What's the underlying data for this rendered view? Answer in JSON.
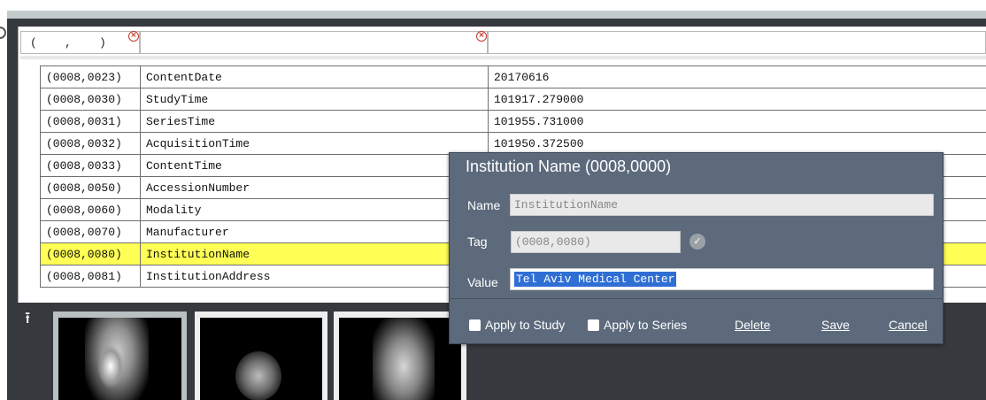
{
  "filters": {
    "tag_value": "(    ,    )",
    "name_value": "",
    "value_value": ""
  },
  "rows": [
    {
      "tag": "(0008,0023)",
      "name": "ContentDate",
      "value": "20170616"
    },
    {
      "tag": "(0008,0030)",
      "name": "StudyTime",
      "value": "101917.279000"
    },
    {
      "tag": "(0008,0031)",
      "name": "SeriesTime",
      "value": "101955.731000"
    },
    {
      "tag": "(0008,0032)",
      "name": "AcquisitionTime",
      "value": "101950.372500"
    },
    {
      "tag": "(0008,0033)",
      "name": "ContentTime",
      "value": ""
    },
    {
      "tag": "(0008,0050)",
      "name": "AccessionNumber",
      "value": ""
    },
    {
      "tag": "(0008,0060)",
      "name": "Modality",
      "value": ""
    },
    {
      "tag": "(0008,0070)",
      "name": "Manufacturer",
      "value": ""
    },
    {
      "tag": "(0008,0080)",
      "name": "InstitutionName",
      "value": "",
      "selected": true
    },
    {
      "tag": "(0008,0081)",
      "name": "InstitutionAddress",
      "value": ""
    }
  ],
  "dialog": {
    "title": "Institution Name (0008,0000)",
    "name_label": "Name",
    "name_value": "InstitutionName",
    "tag_label": "Tag",
    "tag_value": "(0008,0080)",
    "value_label": "Value",
    "value_value": "Tel Aviv Medical Center",
    "apply_study_label": "Apply to Study",
    "apply_series_label": "Apply to Series",
    "delete_label": "Delete",
    "save_label": "Save",
    "cancel_label": "Cancel"
  },
  "icons": {
    "clear": "x-circle-icon",
    "check": "check-circle-icon",
    "collapse": "arrow-up-bar-icon"
  },
  "colors": {
    "selected_row": "#ffff55",
    "dialog_bg": "#5c6a7c",
    "selection": "#2f6fd4"
  }
}
